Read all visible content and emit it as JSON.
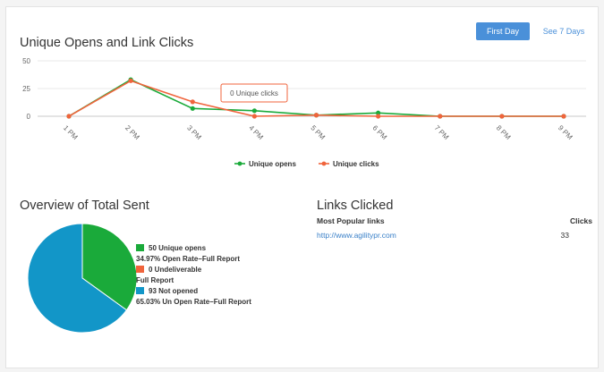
{
  "buttons": {
    "first_day": "First Day",
    "see_7_days": "See 7 Days"
  },
  "line_section": {
    "title": "Unique Opens and Link Clicks"
  },
  "pie_section": {
    "title": "Overview of Total Sent",
    "legend": [
      {
        "main": "50 Unique opens",
        "sub": "34.97% Open Rate–Full Report",
        "color": "#1aaa3a"
      },
      {
        "main": "0 Undeliverable",
        "sub": "Full Report",
        "color": "#f0643c"
      },
      {
        "main": "93 Not opened",
        "sub": "65.03% Un Open Rate–Full Report",
        "color": "#1296c8"
      }
    ]
  },
  "links_section": {
    "title": "Links Clicked",
    "col_link": "Most Popular links",
    "col_clicks": "Clicks",
    "rows": [
      {
        "url": "http://www.agilitypr.com",
        "clicks": "33"
      }
    ]
  },
  "chart_data": [
    {
      "type": "line",
      "title": "Unique Opens and Link Clicks",
      "categories": [
        "1 PM",
        "2 PM",
        "3 PM",
        "4 PM",
        "5 PM",
        "6 PM",
        "7 PM",
        "8 PM",
        "9 PM"
      ],
      "ylim": [
        0,
        50
      ],
      "yticks": [
        0,
        25,
        50
      ],
      "grid": true,
      "legend_position": "bottom",
      "series": [
        {
          "name": "Unique opens",
          "color": "#1aaa3a",
          "values": [
            0,
            33,
            7,
            5,
            1,
            3,
            0,
            0,
            0
          ]
        },
        {
          "name": "Unique clicks",
          "color": "#f0643c",
          "values": [
            0,
            32,
            13,
            0,
            1,
            0,
            0,
            0,
            0
          ]
        }
      ],
      "tooltip": {
        "text": "0 Unique clicks"
      }
    },
    {
      "type": "pie",
      "title": "Overview of Total Sent",
      "labels": [
        "Unique opens",
        "Undeliverable",
        "Not opened"
      ],
      "values": [
        50,
        0,
        93
      ],
      "colors": [
        "#1aaa3a",
        "#f0643c",
        "#1296c8"
      ]
    }
  ]
}
